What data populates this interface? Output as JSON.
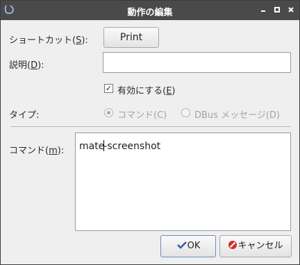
{
  "window": {
    "title": "動作の編集",
    "app_icon": "mate-logo-icon",
    "controls": [
      "minimize-icon",
      "maximize-icon",
      "close-icon"
    ]
  },
  "form": {
    "shortcut": {
      "label_pre": "ショートカット(",
      "mnemonic": "S",
      "label_post": "):",
      "value": "Print"
    },
    "description": {
      "label_pre": "説明(",
      "mnemonic": "D",
      "label_post": "):",
      "value": ""
    },
    "enabled": {
      "label_pre": "有効にする(",
      "mnemonic": "E",
      "label_post": ")",
      "checked": true
    },
    "type": {
      "label": "タイプ:",
      "options": [
        {
          "label": "コマンド(C)",
          "selected": true,
          "disabled": true
        },
        {
          "label": "DBus メッセージ(D)",
          "selected": false,
          "disabled": true
        }
      ]
    },
    "command": {
      "label_pre": "コマンド(",
      "mnemonic": "m",
      "label_post": "):",
      "value_before_caret": "mate",
      "value_after_caret": "-screenshot"
    }
  },
  "buttons": {
    "ok": {
      "label": "OK",
      "icon": "checkmark-icon"
    },
    "cancel": {
      "label": "キャンセル",
      "icon": "cancel-icon"
    }
  },
  "colors": {
    "titlebar": "#4a4a4a",
    "cancel_icon": "#d0302a",
    "ok_icon": "#3a5fa0"
  }
}
